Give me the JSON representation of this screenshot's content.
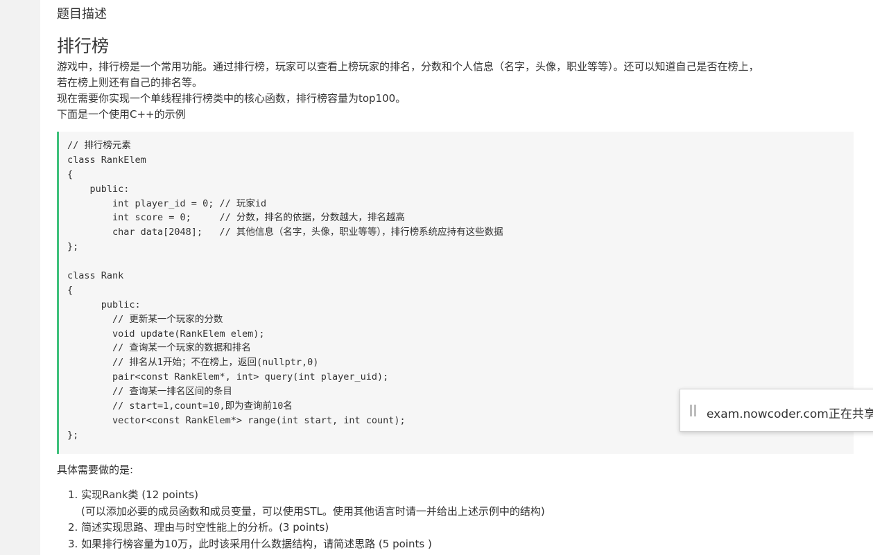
{
  "section_header": "题目描述",
  "title": "排行榜",
  "paragraphs": [
    "游戏中，排行榜是一个常用功能。通过排行榜，玩家可以查看上榜玩家的排名，分数和个人信息（名字，头像，职业等等）。还可以知道自己是否在榜上，",
    "若在榜上则还有自己的排名等。",
    "现在需要你实现一个单线程排行榜类中的核心函数，排行榜容量为top100。",
    "下面是一个使用C++的示例"
  ],
  "code_lines": [
    "// 排行榜元素",
    "class RankElem",
    "{",
    "    public:",
    "        int player_id = 0; // 玩家id",
    "        int score = 0;     // 分数，排名的依据，分数越大，排名越高",
    "        char data[2048];   // 其他信息（名字，头像，职业等等），排行榜系统应持有这些数据",
    "};",
    "",
    "class Rank",
    "{",
    "      public:",
    "        // 更新某一个玩家的分数",
    "        void update(RankElem elem);",
    "        // 查询某一个玩家的数据和排名",
    "        // 排名从1开始；不在榜上，返回(nullptr,0)",
    "        pair<const RankElem*, int> query(int player_uid);",
    "        // 查询某一排名区间的条目",
    "        // start=1,count=10,即为查询前10名",
    "        vector<const RankElem*> range(int start, int count);",
    "};"
  ],
  "requirements_title": "具体需要做的是:",
  "requirements": [
    {
      "text": "1. 实现Rank类 (12 points)",
      "sub": "(可以添加必要的成员函数和成员变量，可以使用STL。使用其他语言时请一并给出上述示例中的结构)"
    },
    {
      "text": "2. 简述实现思路、理由与时空性能上的分析。(3 points)",
      "sub": ""
    },
    {
      "text": "3. 如果排行榜容量为10万，此时该采用什么数据结构，请简述思路 (5 points )",
      "sub": ""
    }
  ],
  "notification": {
    "text": "exam.nowcoder.com正在共享",
    "icon": "pause-icon"
  },
  "colors": {
    "code_border": "#3ec07a",
    "code_bg": "#f6f6f6",
    "gutter_bg": "#f2f2f2"
  }
}
